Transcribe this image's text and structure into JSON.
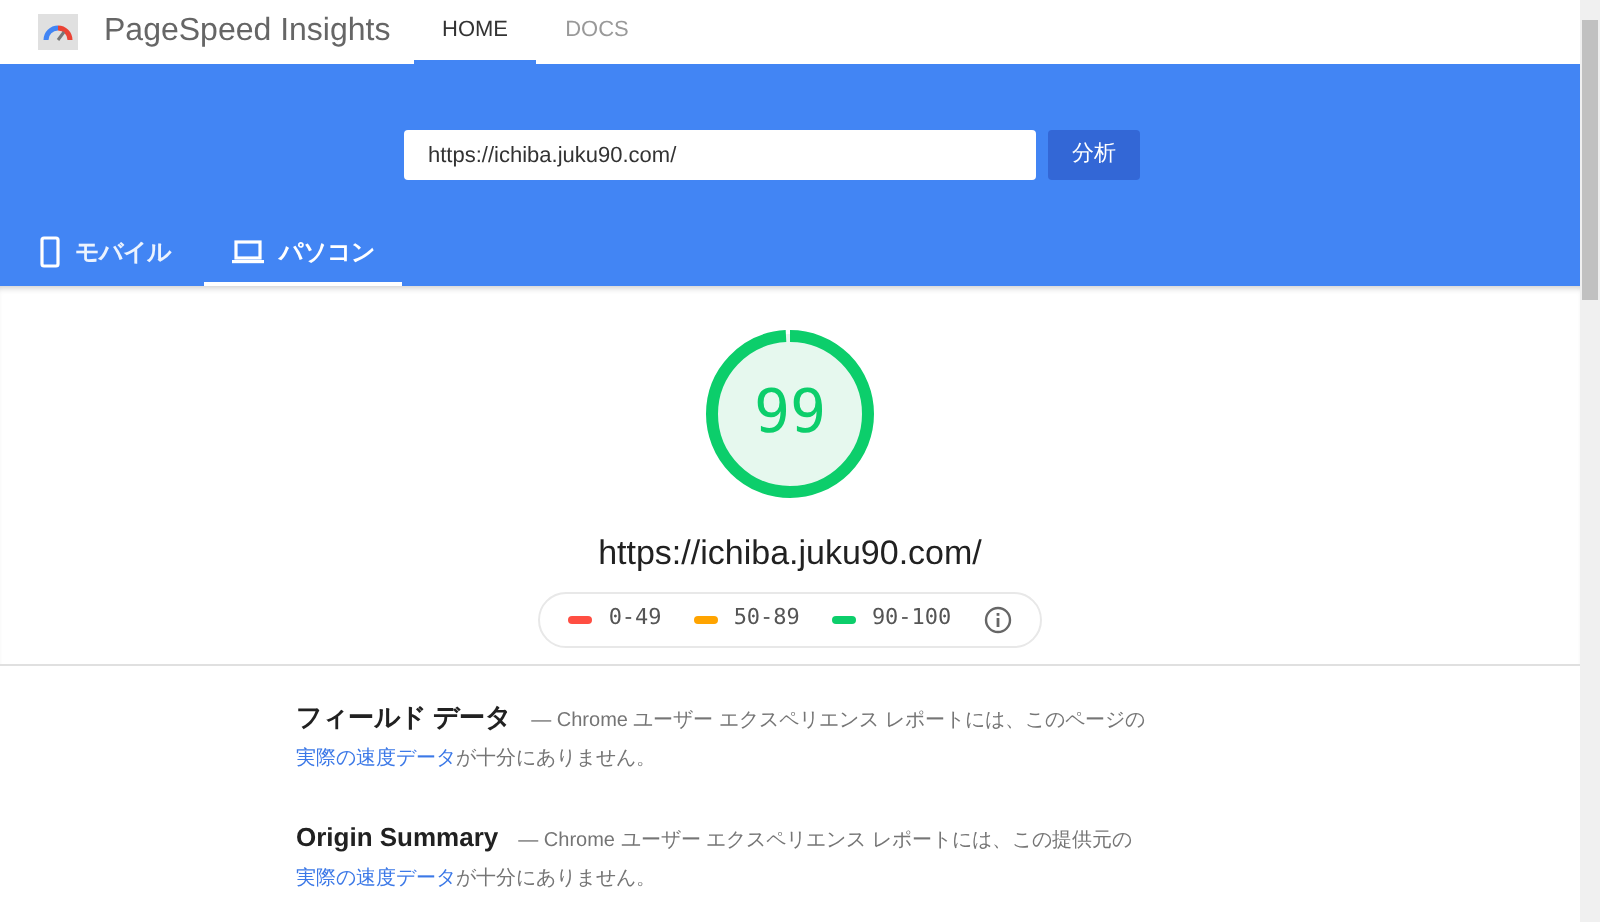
{
  "header": {
    "title": "PageSpeed Insights",
    "nav": [
      {
        "label": "HOME",
        "selected": true
      },
      {
        "label": "DOCS",
        "selected": false
      }
    ]
  },
  "search": {
    "value": "https://ichiba.juku90.com/",
    "button": "分析"
  },
  "device_tabs": [
    {
      "kind": "mobile",
      "label": "モバイル",
      "selected": false
    },
    {
      "kind": "desktop",
      "label": "パソコン",
      "selected": true
    }
  ],
  "score": {
    "value": "99",
    "level": 0.99,
    "url": "https://ichiba.juku90.com/"
  },
  "legend": [
    {
      "label": "0-49",
      "color": "#ff4e42"
    },
    {
      "label": "50-89",
      "color": "#ffa400"
    },
    {
      "label": "90-100",
      "color": "#0cce6b"
    }
  ],
  "sections": [
    {
      "title": "フィールド データ",
      "text": "— Chrome ユーザー エクスペリエンス レポートには、このページの",
      "link": "実際の速度データ",
      "after": "が十分にありません。"
    },
    {
      "title": "Origin Summary",
      "text": "— Chrome ユーザー エクスペリエンス レポートには、この提供元の",
      "link": "実際の速度データ",
      "after": "が十分にありません。"
    }
  ]
}
